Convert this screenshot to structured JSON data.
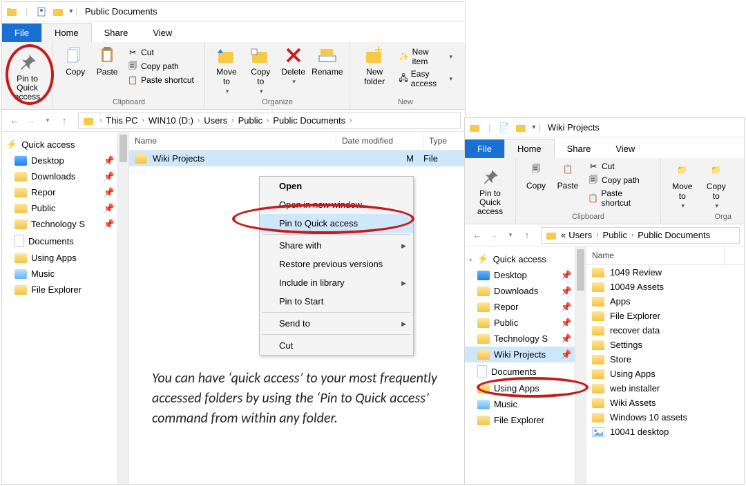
{
  "win1": {
    "title": "Public Documents",
    "tabs": {
      "file": "File",
      "home": "Home",
      "share": "Share",
      "view": "View"
    },
    "ribbon": {
      "pin_to_quick_access": "Pin to Quick access",
      "copy": "Copy",
      "paste": "Paste",
      "cut": "Cut",
      "copy_path": "Copy path",
      "paste_shortcut": "Paste shortcut",
      "clipboard_group": "Clipboard",
      "move_to": "Move to",
      "copy_to": "Copy to",
      "delete": "Delete",
      "rename": "Rename",
      "organize_group": "Organize",
      "new_folder": "New folder",
      "new_item": "New item",
      "easy_access": "Easy access",
      "new_group": "New"
    },
    "breadcrumb": [
      "This PC",
      "WIN10 (D:)",
      "Users",
      "Public",
      "Public Documents"
    ],
    "tree": {
      "quick_access": "Quick access",
      "items": [
        {
          "label": "Desktop",
          "pinned": true
        },
        {
          "label": "Downloads",
          "pinned": true
        },
        {
          "label": "Repor",
          "pinned": true
        },
        {
          "label": "Public",
          "pinned": true
        },
        {
          "label": "Technology S",
          "pinned": true
        },
        {
          "label": "Documents",
          "pinned": false
        },
        {
          "label": "Using Apps",
          "pinned": false
        },
        {
          "label": "Music",
          "pinned": false
        },
        {
          "label": "File Explorer",
          "pinned": false
        }
      ]
    },
    "columns": {
      "name": "Name",
      "date": "Date modified",
      "type": "Type"
    },
    "file_row": {
      "name": "Wiki Projects",
      "date_tail": "M",
      "type": "File"
    },
    "context_menu": {
      "open": "Open",
      "open_new_window": "Open in new window",
      "pin_to_quick_access": "Pin to Quick access",
      "share_with": "Share with",
      "restore_prev": "Restore previous versions",
      "include_in_library": "Include in library",
      "pin_to_start": "Pin to Start",
      "send_to": "Send to",
      "cut": "Cut"
    }
  },
  "win2": {
    "title": "Wiki Projects",
    "tabs": {
      "file": "File",
      "home": "Home",
      "share": "Share",
      "view": "View"
    },
    "ribbon": {
      "pin_to_quick_access": "Pin to Quick access",
      "copy": "Copy",
      "paste": "Paste",
      "cut": "Cut",
      "copy_path": "Copy path",
      "paste_shortcut": "Paste shortcut",
      "clipboard_group": "Clipboard",
      "move_to": "Move to",
      "copy_to": "Copy to",
      "organize_group": "Orga"
    },
    "breadcrumb_prefix": "«",
    "breadcrumb": [
      "Users",
      "Public",
      "Public Documents"
    ],
    "tree": {
      "quick_access": "Quick access",
      "items": [
        {
          "label": "Desktop",
          "pinned": true
        },
        {
          "label": "Downloads",
          "pinned": true
        },
        {
          "label": "Repor",
          "pinned": true
        },
        {
          "label": "Public",
          "pinned": true
        },
        {
          "label": "Technology S",
          "pinned": true
        },
        {
          "label": "Wiki Projects",
          "pinned": true,
          "selected": true
        },
        {
          "label": "Documents",
          "pinned": false
        },
        {
          "label": "Using Apps",
          "pinned": false
        },
        {
          "label": "Music",
          "pinned": false
        },
        {
          "label": "File Explorer",
          "pinned": false
        }
      ]
    },
    "columns": {
      "name": "Name"
    },
    "files": [
      "1049 Review",
      "10049 Assets",
      "Apps",
      "File Explorer",
      "recover data",
      "Settings",
      "Store",
      "Using Apps",
      "web installer",
      "Wiki Assets",
      "Windows 10 assets",
      "10041 desktop"
    ]
  },
  "caption": "You can have ‘quick access’ to your most frequently accessed folders by using the ‘Pin to Quick access’ command from within any folder."
}
